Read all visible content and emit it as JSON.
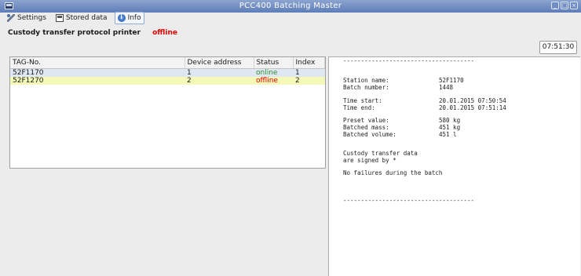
{
  "window": {
    "title": "PCC400 Batching Master",
    "buttons": [
      "_",
      "□",
      "×"
    ]
  },
  "toolbar": {
    "settings_label": "Settings",
    "stored_data_label": "Stored data",
    "info_label": "Info"
  },
  "protocol": {
    "label": "Custody transfer protocol printer",
    "state": "offline"
  },
  "clock": "07:51:30",
  "table": {
    "headers": [
      "TAG-No.",
      "Device address",
      "Status",
      "Index"
    ],
    "rows": [
      {
        "tag": "52F1170",
        "address": "1",
        "status": "online",
        "index": "1"
      },
      {
        "tag": "52F1270",
        "address": "2",
        "status": "offline",
        "index": "2"
      }
    ]
  },
  "report": {
    "separator": "-------------------------------------",
    "station_label": "Station name:",
    "station_value": "52F1170",
    "batch_label": "Batch number:",
    "batch_value": "1448",
    "time_start_label": "Time start:",
    "time_start_value": "20.01.2015 07:50:54",
    "time_end_label": "Time end:",
    "time_end_value": "20.01.2015 07:51:14",
    "preset_label": "Preset value:",
    "preset_value": "580 kg",
    "mass_label": "Batched mass:",
    "mass_value": "451 kg",
    "volume_label": "Batched volume:",
    "volume_value": "451 l",
    "signed_line1": "Custody transfer data",
    "signed_line2": "are signed by *",
    "failures": "No failures during the batch"
  }
}
